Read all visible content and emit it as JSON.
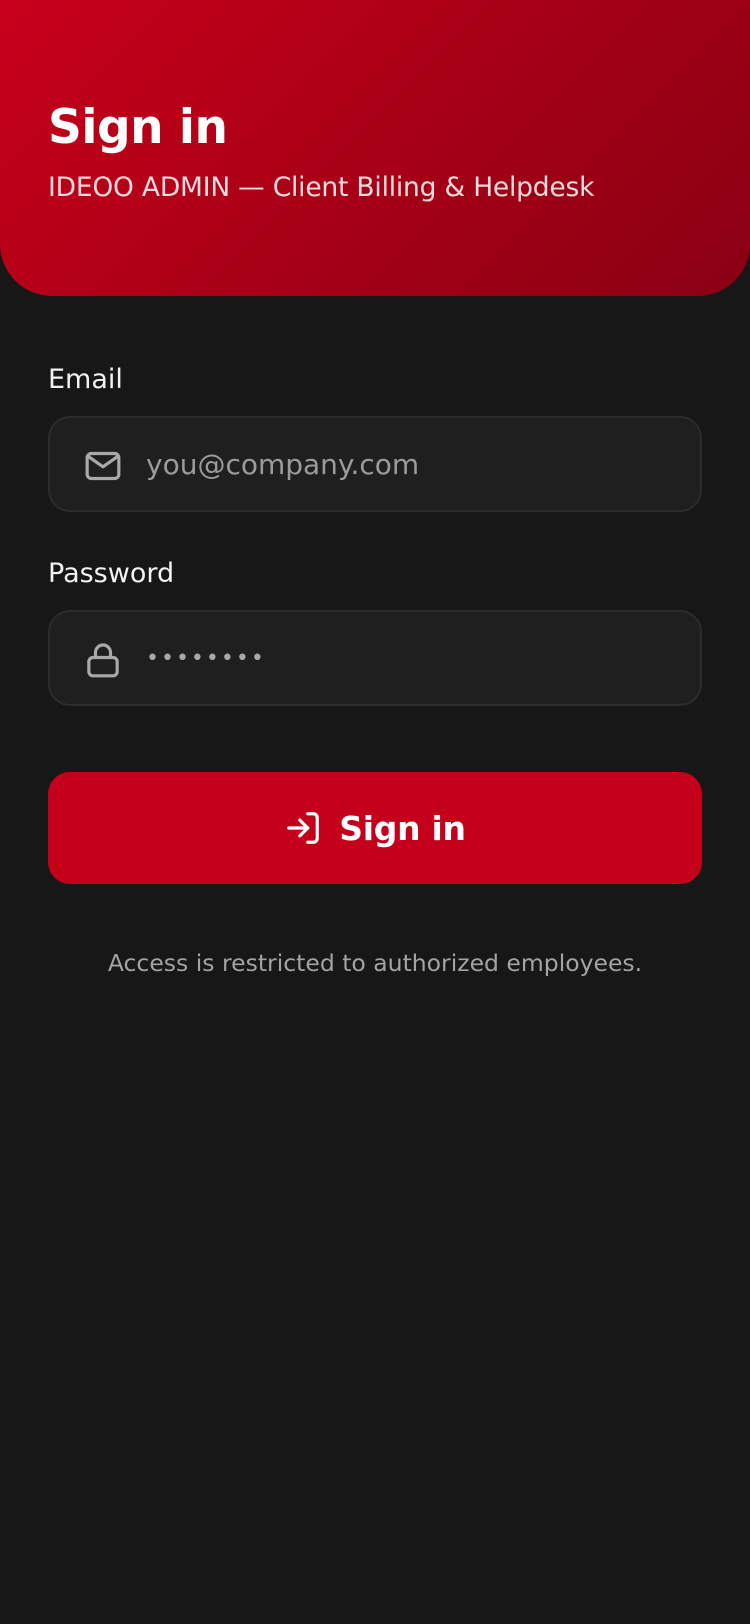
{
  "header": {
    "title": "Sign in",
    "subtitle": "IDEOO ADMIN — Client Billing & Helpdesk"
  },
  "form": {
    "email": {
      "label": "Email",
      "placeholder": "you@company.com",
      "value": "",
      "icon": "mail-icon"
    },
    "password": {
      "label": "Password",
      "value": "••••••••",
      "icon": "lock-icon"
    },
    "submit": {
      "label": "Sign in",
      "icon": "sign-in-icon"
    }
  },
  "footer": {
    "note": "Access is restricted to authorized employees."
  },
  "colors": {
    "accent": "#c4001a",
    "header_gradient_start": "#c8001b",
    "header_gradient_end": "#8a0013",
    "background": "#171717",
    "field_background": "#1f1f1f"
  }
}
